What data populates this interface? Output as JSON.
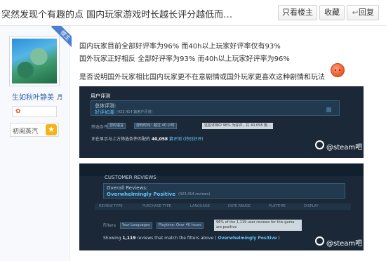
{
  "post": {
    "title": "突然发现个有趣的点 国内玩家游戏时长越长评分越低而…",
    "actions": {
      "only_host": "只看楼主",
      "favorite": "收藏",
      "reply": "回复"
    }
  },
  "author": {
    "host_tag": "楼主",
    "username": "生如秋叶静美 ♬",
    "level_name": "初阅蒸汽",
    "level_icon": "star-icon"
  },
  "content": {
    "paragraphs": [
      "国内玩家目前全部好评率为96% 而40h以上玩家好评率仅有93%",
      "国外玩家正好相反 全部好评率为93% 而40h以上玩家好评率为96%",
      "是否说明国外玩家相比国内玩家更不在意剧情或国外玩家更喜欢这种剧情和玩法"
    ]
  },
  "screenshot_cn": {
    "header": "用户评测",
    "overall_label": "总体评测:",
    "overall_value": "好评如潮",
    "overall_count": "(423,414 篇用户评测)",
    "filters_label": "筛选条件",
    "filter_chips": [
      "您的语言",
      "游戏时间：超过 40 小时"
    ],
    "filter_tip": "这些评测中 96% 为好评，共 40,058 篇…",
    "showing_prefix": "正在显示与上方筛选条件匹配的",
    "showing_count": "40,058",
    "showing_suffix": "篇评测 (特别好评)",
    "watermark": "@steam吧"
  },
  "screenshot_en": {
    "header": "CUSTOMER REVIEWS",
    "overall_label": "Overall Reviews:",
    "overall_value": "Overwhelmingly Positive",
    "overall_count": "(423,414 reviews)",
    "tabs": [
      "REVIEW TYPE",
      "PURCHASE TYPE",
      "LANGUAGE",
      "DATE RANGE",
      "PLAYTIME",
      "DISPLAY"
    ],
    "filters_label": "Filters",
    "filter_chips": [
      "Your Languages",
      "Playtime: Over 40 hours"
    ],
    "filter_tip": "96% of the 1,119 user reviews for this game are positive",
    "showing_prefix": "Showing",
    "showing_count": "1,119",
    "showing_suffix": "reviews that match the filters above (",
    "showing_rating": "Overwhelmingly Positive",
    "showing_end": ")",
    "watermark": "@steam吧"
  },
  "colors": {
    "link_blue": "#2d64b3",
    "steam_bg": "#1b2838",
    "steam_accent": "#66c0f4",
    "host_tag": "#4c7fd0"
  }
}
